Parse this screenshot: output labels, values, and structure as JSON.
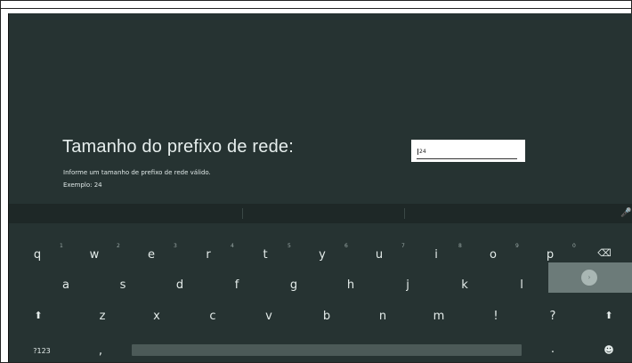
{
  "form": {
    "title": "Tamanho do prefixo de rede:",
    "hint": "Informe um tamanho de prefixo de rede válido.",
    "example": "Exemplo: 24",
    "input_value": "24"
  },
  "keyboard": {
    "row1": [
      {
        "key": "q",
        "hint": "1"
      },
      {
        "key": "w",
        "hint": "2"
      },
      {
        "key": "e",
        "hint": "3"
      },
      {
        "key": "r",
        "hint": "4"
      },
      {
        "key": "t",
        "hint": "5"
      },
      {
        "key": "y",
        "hint": "6"
      },
      {
        "key": "u",
        "hint": "7"
      },
      {
        "key": "i",
        "hint": "8"
      },
      {
        "key": "o",
        "hint": "9"
      },
      {
        "key": "p",
        "hint": "0"
      }
    ],
    "row2": [
      "a",
      "s",
      "d",
      "f",
      "g",
      "h",
      "j",
      "k",
      "l"
    ],
    "row3": [
      "z",
      "x",
      "c",
      "v",
      "b",
      "n",
      "m",
      "!",
      "?"
    ],
    "numbers_label": "?123",
    "comma": ",",
    "period": ".",
    "icons": {
      "backspace": "backspace-icon",
      "enter": "enter-icon",
      "shift": "shift-icon",
      "emoji": "emoji-icon",
      "mic": "microphone-icon"
    }
  }
}
